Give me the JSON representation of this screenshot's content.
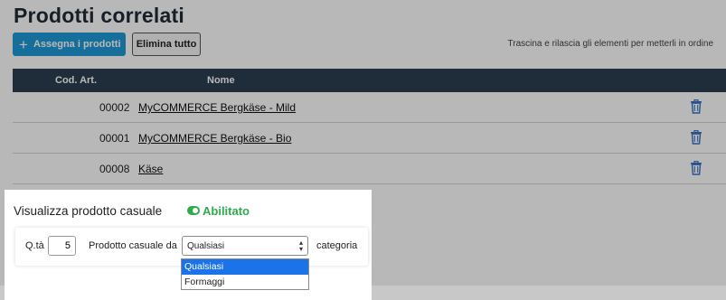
{
  "page": {
    "title": "Prodotti correlati",
    "assign_label": "Assegna i prodotti",
    "delete_all_label": "Elimina tutto",
    "hint": "Trascina e rilascia gli elementi per metterli in ordine"
  },
  "table": {
    "headers": [
      "Cod. Art.",
      "Nome"
    ],
    "rows": [
      {
        "code": "00002",
        "name": "MyCOMMERCE Bergkäse - Mild"
      },
      {
        "code": "00001",
        "name": "MyCOMMERCE Bergkäse - Bio"
      },
      {
        "code": "00008",
        "name": "Käse"
      }
    ]
  },
  "random": {
    "title": "Visualizza prodotto casuale",
    "status": "Abilitato",
    "qty_label": "Q.tà",
    "qty_value": "5",
    "from_label": "Prodotto casuale da",
    "category_selected": "Qualsiasi",
    "category_suffix": "categoria",
    "options": [
      "Qualsiasi",
      "Formaggi"
    ]
  },
  "colors": {
    "accent": "#1e9ad6",
    "header": "#2c3e50",
    "enabled": "#2eab4a",
    "selected_option": "#1a73e8"
  }
}
